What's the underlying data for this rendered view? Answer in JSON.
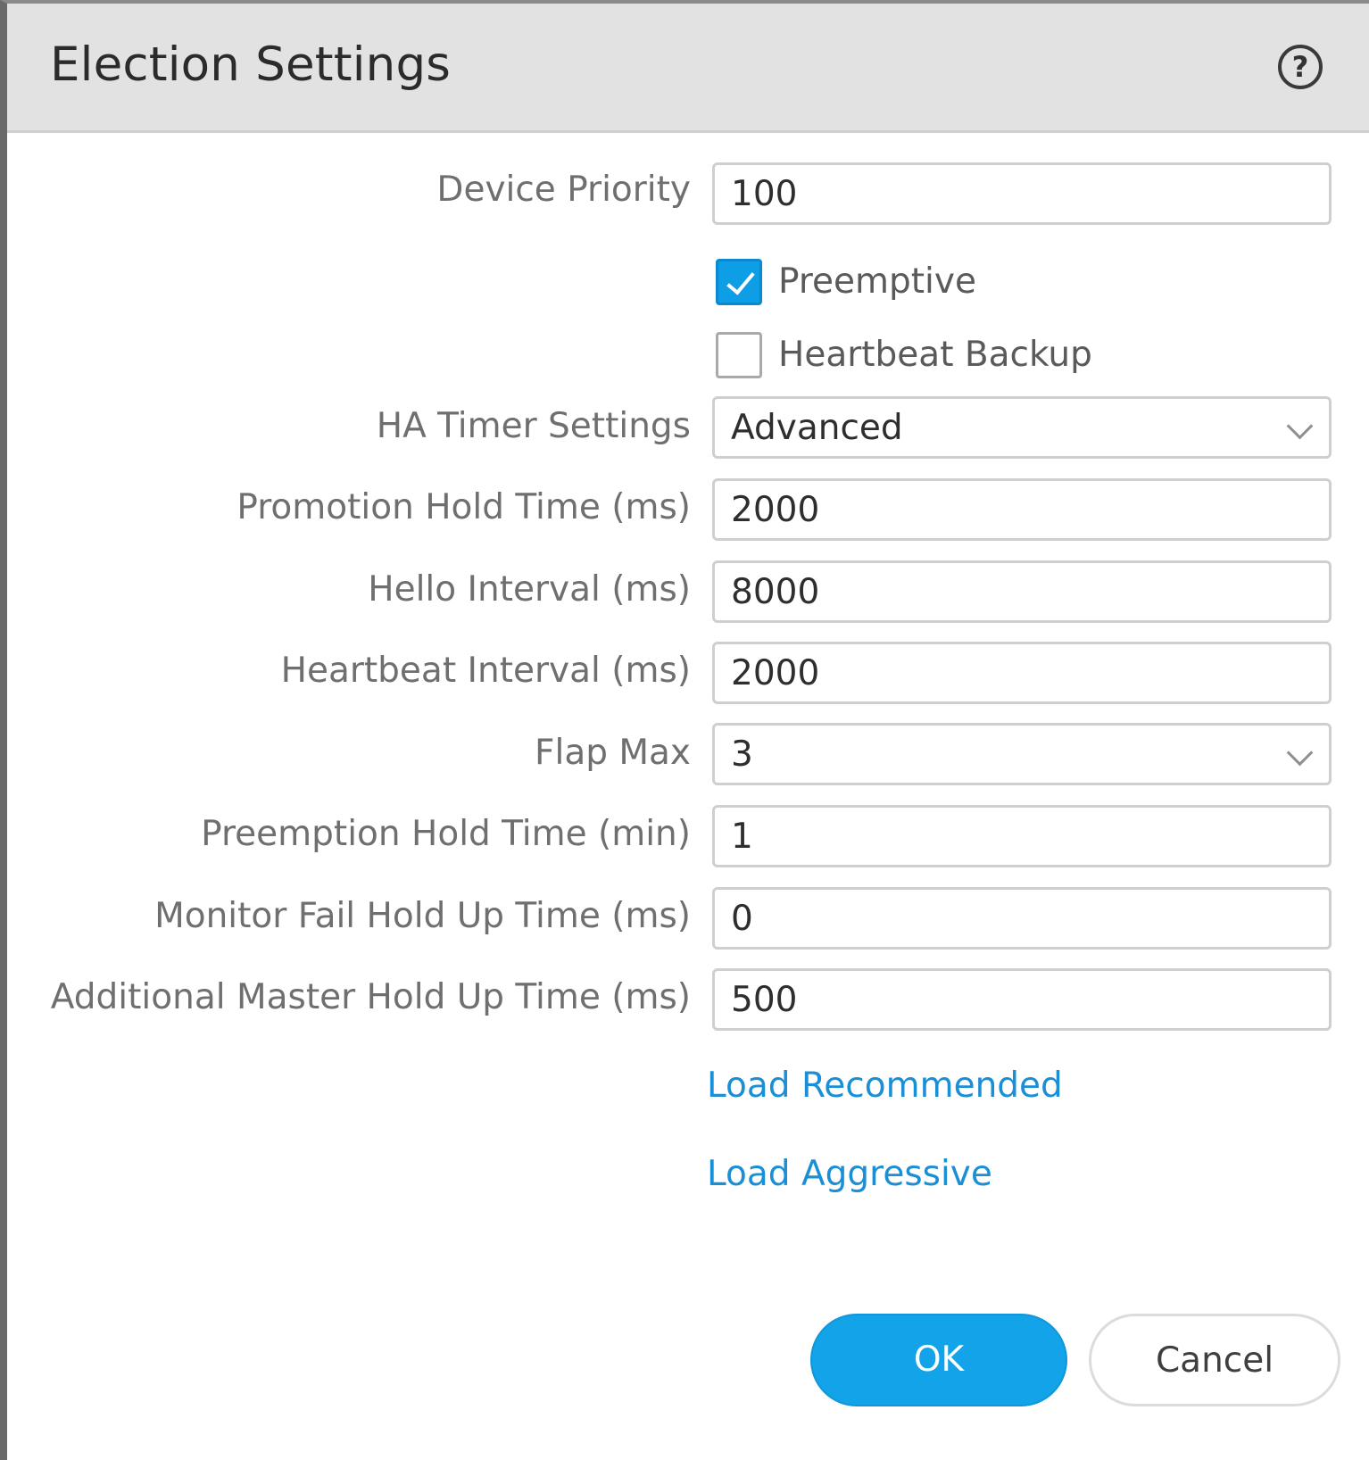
{
  "dialog": {
    "title": "Election Settings",
    "help_icon": "help-circle-icon",
    "help_glyph": "?"
  },
  "fields": {
    "device_priority": {
      "label": "Device Priority",
      "value": "100"
    },
    "preemptive": {
      "label": "Preemptive",
      "checked": true
    },
    "heartbeat_backup": {
      "label": "Heartbeat Backup",
      "checked": false
    },
    "ha_timer_settings": {
      "label": "HA Timer Settings",
      "value": "Advanced"
    },
    "promotion_hold_time": {
      "label": "Promotion Hold Time (ms)",
      "value": "2000"
    },
    "hello_interval": {
      "label": "Hello Interval (ms)",
      "value": "8000"
    },
    "heartbeat_interval": {
      "label": "Heartbeat Interval (ms)",
      "value": "2000"
    },
    "flap_max": {
      "label": "Flap Max",
      "value": "3"
    },
    "preemption_hold_time": {
      "label": "Preemption Hold Time (min)",
      "value": "1"
    },
    "monitor_fail_hold_up_time": {
      "label": "Monitor Fail Hold Up Time (ms)",
      "value": "0"
    },
    "additional_master_hold_up_time": {
      "label": "Additional Master Hold Up Time (ms)",
      "value": "500"
    }
  },
  "links": {
    "load_recommended": "Load Recommended",
    "load_aggressive": "Load Aggressive"
  },
  "buttons": {
    "ok": "OK",
    "cancel": "Cancel"
  },
  "colors": {
    "accent": "#12a3e9",
    "link": "#1b8fd6",
    "titlebar": "#e2e2e2"
  }
}
